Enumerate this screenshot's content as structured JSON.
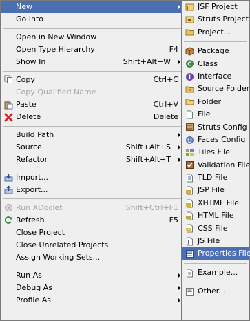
{
  "main_menu": {
    "items": [
      {
        "id": "new",
        "label": "New",
        "submenu": true,
        "selected": true
      },
      {
        "id": "go-into",
        "label": "Go Into"
      },
      {
        "sep": true
      },
      {
        "id": "open-new-window",
        "label": "Open in New Window"
      },
      {
        "id": "open-type-hierarchy",
        "label": "Open Type Hierarchy",
        "accel": "F4"
      },
      {
        "id": "show-in",
        "label": "Show In",
        "accel": "Shift+Alt+W",
        "submenu": true
      },
      {
        "sep": true
      },
      {
        "id": "copy",
        "label": "Copy",
        "accel": "Ctrl+C",
        "icon": "copy-icon"
      },
      {
        "id": "copy-qualified-name",
        "label": "Copy Qualified Name",
        "disabled": true
      },
      {
        "id": "paste",
        "label": "Paste",
        "accel": "Ctrl+V",
        "icon": "paste-icon"
      },
      {
        "id": "delete",
        "label": "Delete",
        "accel": "Delete",
        "icon": "delete-icon"
      },
      {
        "sep": true
      },
      {
        "id": "build-path",
        "label": "Build Path",
        "submenu": true
      },
      {
        "id": "source",
        "label": "Source",
        "accel": "Shift+Alt+S",
        "submenu": true
      },
      {
        "id": "refactor",
        "label": "Refactor",
        "accel": "Shift+Alt+T",
        "submenu": true
      },
      {
        "sep": true
      },
      {
        "id": "import",
        "label": "Import...",
        "icon": "import-icon"
      },
      {
        "id": "export",
        "label": "Export...",
        "icon": "export-icon"
      },
      {
        "sep": true
      },
      {
        "id": "run-xdoclet",
        "label": "Run XDoclet",
        "accel": "Shift+Ctrl+F1",
        "disabled": true,
        "icon": "xdoclet-icon"
      },
      {
        "id": "refresh",
        "label": "Refresh",
        "accel": "F5",
        "icon": "refresh-icon"
      },
      {
        "id": "close-project",
        "label": "Close Project"
      },
      {
        "id": "close-unrelated-projects",
        "label": "Close Unrelated Projects"
      },
      {
        "id": "assign-working-sets",
        "label": "Assign Working Sets..."
      },
      {
        "sep": true
      },
      {
        "id": "run-as",
        "label": "Run As",
        "submenu": true
      },
      {
        "id": "debug-as",
        "label": "Debug As",
        "submenu": true
      },
      {
        "id": "profile-as",
        "label": "Profile As",
        "submenu": true
      }
    ]
  },
  "sub_menu": {
    "items": [
      {
        "id": "jsf-project",
        "label": "JSF Project",
        "icon": "jsf-project-icon"
      },
      {
        "id": "struts-project",
        "label": "Struts Project",
        "icon": "struts-project-icon"
      },
      {
        "id": "project",
        "label": "Project...",
        "icon": "project-icon"
      },
      {
        "sep": true
      },
      {
        "id": "package",
        "label": "Package",
        "icon": "package-icon"
      },
      {
        "id": "class",
        "label": "Class",
        "icon": "class-icon"
      },
      {
        "id": "interface",
        "label": "Interface",
        "icon": "interface-icon"
      },
      {
        "id": "source-folder",
        "label": "Source Folder",
        "icon": "source-folder-icon"
      },
      {
        "id": "folder",
        "label": "Folder",
        "icon": "folder-icon"
      },
      {
        "id": "file",
        "label": "File",
        "icon": "file-icon"
      },
      {
        "id": "struts-config",
        "label": "Struts Config",
        "icon": "struts-config-icon"
      },
      {
        "id": "faces-config",
        "label": "Faces Config",
        "icon": "faces-config-icon"
      },
      {
        "id": "tiles-file",
        "label": "Tiles File",
        "icon": "tiles-file-icon"
      },
      {
        "id": "validation-file",
        "label": "Validation File",
        "icon": "validation-file-icon"
      },
      {
        "id": "tld-file",
        "label": "TLD File",
        "icon": "tld-file-icon"
      },
      {
        "id": "jsp-file",
        "label": "JSP File",
        "icon": "jsp-file-icon"
      },
      {
        "id": "xhtml-file",
        "label": "XHTML File",
        "icon": "xhtml-file-icon"
      },
      {
        "id": "html-file",
        "label": "HTML File",
        "icon": "html-file-icon"
      },
      {
        "id": "css-file",
        "label": "CSS File",
        "icon": "css-file-icon"
      },
      {
        "id": "js-file",
        "label": "JS File",
        "icon": "js-file-icon"
      },
      {
        "id": "properties-file",
        "label": "Properties File",
        "icon": "properties-file-icon",
        "selected": true
      },
      {
        "sep": true
      },
      {
        "id": "example",
        "label": "Example...",
        "icon": "example-icon"
      },
      {
        "sep": true
      },
      {
        "id": "other",
        "label": "Other...",
        "icon": "other-icon"
      }
    ]
  },
  "colors": {
    "menu_bg": "#efefef",
    "selection_bg": "#4b6fb3",
    "disabled_text": "#a6a6a6"
  }
}
